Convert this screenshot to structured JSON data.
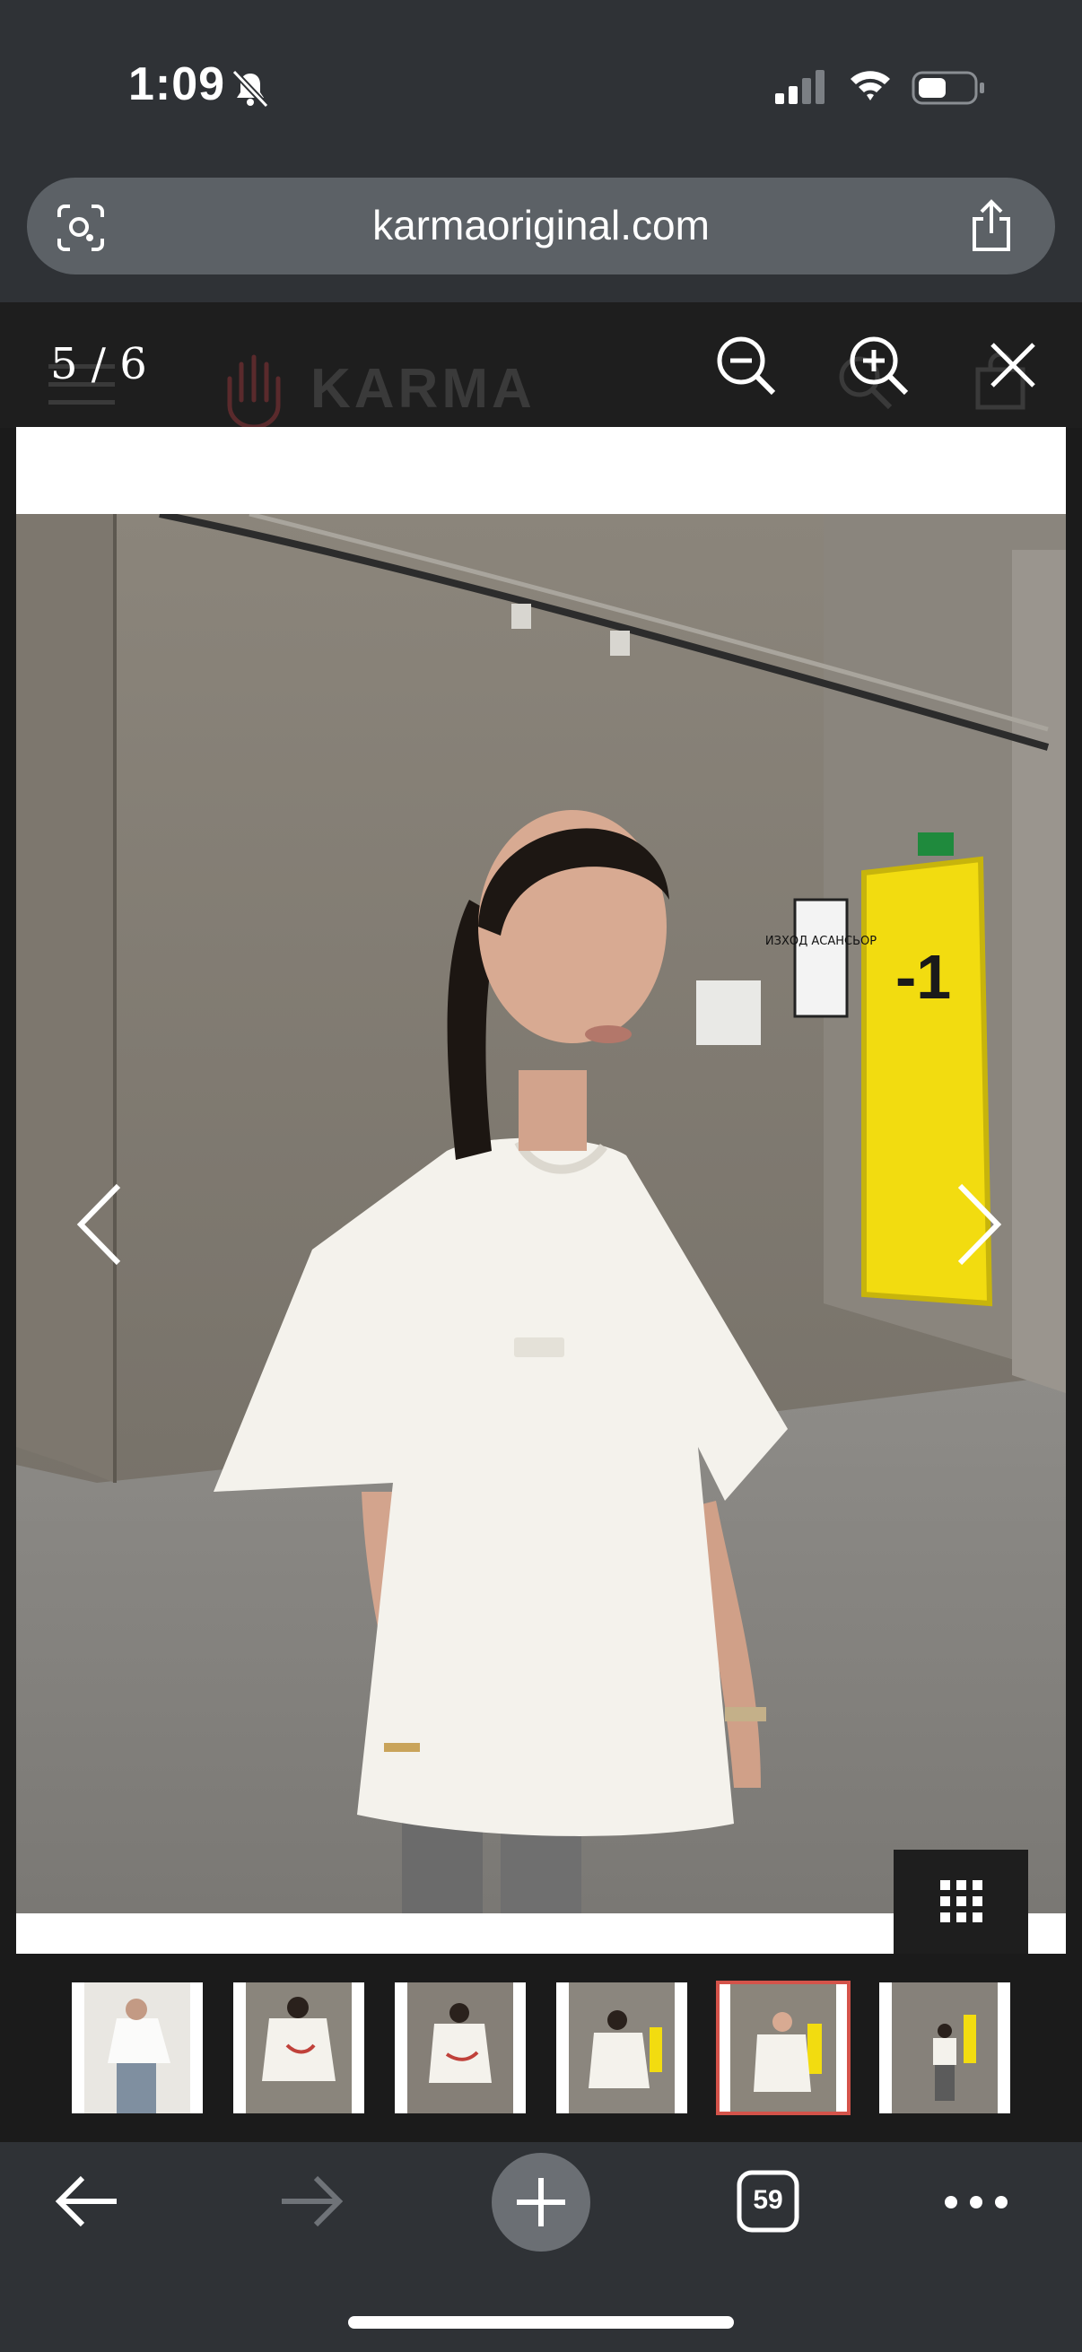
{
  "status_bar": {
    "time": "1:09",
    "icons": [
      "bell-slash-icon",
      "cellular-signal-icon",
      "wifi-icon",
      "battery-icon"
    ]
  },
  "browser": {
    "url": "karmaoriginal.com",
    "tabs_count": "59",
    "icons": [
      "lens-icon",
      "share-icon",
      "back-arrow-icon",
      "forward-arrow-icon",
      "plus-icon",
      "tabs-icon",
      "more-icon"
    ]
  },
  "site_header": {
    "logo_text": "KARMA",
    "icons": [
      "hamburger-icon",
      "hand-logo-icon",
      "search-icon",
      "bag-icon"
    ]
  },
  "lightbox": {
    "counter": "5 / 6",
    "current_index": 5,
    "total_images": 6,
    "icons": [
      "zoom-out-icon",
      "zoom-in-icon",
      "close-icon",
      "chevron-left-icon",
      "chevron-right-icon",
      "grid-icon"
    ],
    "photo_signage": {
      "sign_text": "ИЗХОД АСАНСЬОР",
      "door_text": "-1"
    }
  },
  "thumbnails": {
    "count": 6,
    "active_index": 5
  },
  "colors": {
    "chrome_background": "#2f3236",
    "address_bar": "#5c6166",
    "viewer_background": "#1b1b1b",
    "active_thumbnail_border": "#d4534a",
    "door_yellow": "#f2dc10"
  }
}
